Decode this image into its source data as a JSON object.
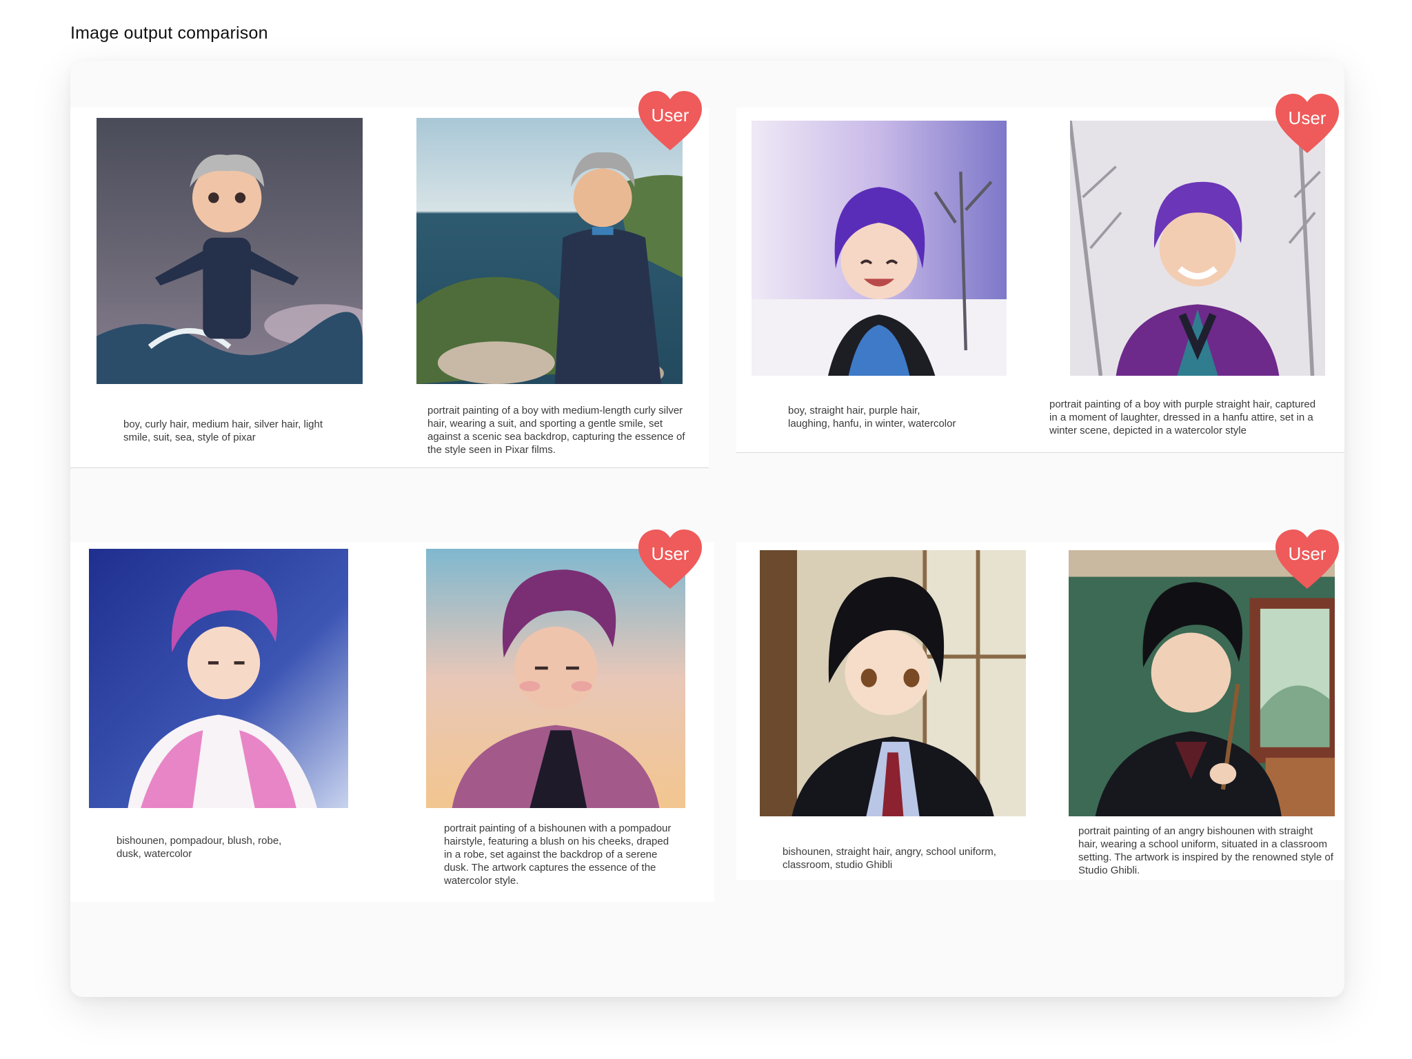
{
  "page": {
    "title": "Image output comparison"
  },
  "badge": {
    "label": "User",
    "color": "#ef5a5a"
  },
  "comparisons": [
    {
      "left_caption": "boy, curly hair, medium hair, silver hair, light smile, suit, sea, style of pixar",
      "right_caption": "portrait painting of a boy with medium-length curly silver hair, wearing a suit, and sporting a gentle smile, set against a scenic sea backdrop, capturing the essence of the style seen in Pixar films.",
      "left_image": "pixar-boy-silver-hair-suit-sea-waves",
      "right_image": "boy-silver-curly-hair-suit-coastal-cliff"
    },
    {
      "left_caption": "boy, straight hair, purple hair, laughing, hanfu, in winter, watercolor",
      "right_caption": "portrait painting of a boy with purple straight hair, captured in a moment of laughter, dressed in a hanfu attire, set in a winter scene, depicted in a watercolor style",
      "left_image": "watercolor-boy-purple-hair-laughing-snowy-trees",
      "right_image": "boy-purple-hair-smiling-hanfu-snowy-road"
    },
    {
      "left_caption": "bishounen, pompadour, blush, robe, dusk, watercolor",
      "right_caption": "portrait painting of a bishounen with a pompadour hairstyle, featuring a blush on his cheeks, draped in a robe, set against the backdrop of a serene dusk. The artwork captures the essence of the watercolor style.",
      "left_image": "anime-man-pink-pompadour-white-robe-blue-sky",
      "right_image": "man-purple-pompadour-robe-dusk-gradient"
    },
    {
      "left_caption": "bishounen, straight hair, angry, school uniform, classroom, studio Ghibli",
      "right_caption": "portrait painting of an angry bishounen with straight hair, wearing a school uniform, situated in a classroom setting. The artwork is inspired by the renowned style of Studio Ghibli.",
      "left_image": "anime-boy-black-hair-school-uniform-window",
      "right_image": "boy-black-hair-holding-brush-classroom"
    }
  ]
}
